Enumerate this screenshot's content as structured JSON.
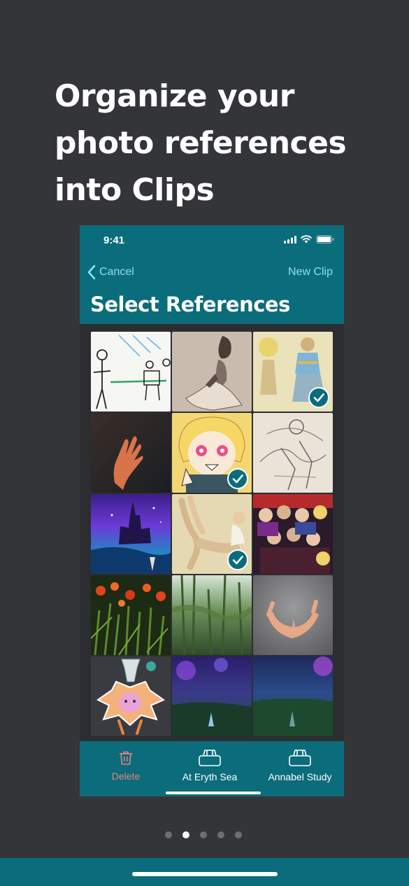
{
  "headline": [
    "Organize your",
    "photo references",
    "into Clips"
  ],
  "status": {
    "time": "9:41"
  },
  "nav": {
    "back_label": "Cancel",
    "action_label": "New Clip",
    "title": "Select References"
  },
  "photos": [
    {
      "name": "stick-figure-sketch",
      "selected": false
    },
    {
      "name": "pencil-figure-drawing",
      "selected": false
    },
    {
      "name": "yellow-character-sketch",
      "selected": true
    },
    {
      "name": "hand-photo",
      "selected": false
    },
    {
      "name": "anime-character",
      "selected": true
    },
    {
      "name": "pencil-battle-sketch",
      "selected": false
    },
    {
      "name": "fantasy-castle-painting",
      "selected": false
    },
    {
      "name": "posing-model-photo",
      "selected": true
    },
    {
      "name": "character-group-illustration",
      "selected": false
    },
    {
      "name": "red-flowers-photo",
      "selected": false
    },
    {
      "name": "bamboo-forest-photo",
      "selected": false
    },
    {
      "name": "cupped-hands-photo",
      "selected": false
    },
    {
      "name": "maple-leaf-mascot",
      "selected": false
    },
    {
      "name": "purple-forest-scene",
      "selected": false
    },
    {
      "name": "night-meadow-scene",
      "selected": false
    }
  ],
  "tabbar": {
    "delete_label": "Delete",
    "clip1_label": "At Eryth Sea",
    "clip2_label": "Annabel Study"
  },
  "colors": {
    "brand": "#0b6c7b",
    "background": "#343539",
    "delete": "#e8837d",
    "link": "#8fe0ea"
  },
  "pagination": {
    "count": 5,
    "active": 2
  }
}
